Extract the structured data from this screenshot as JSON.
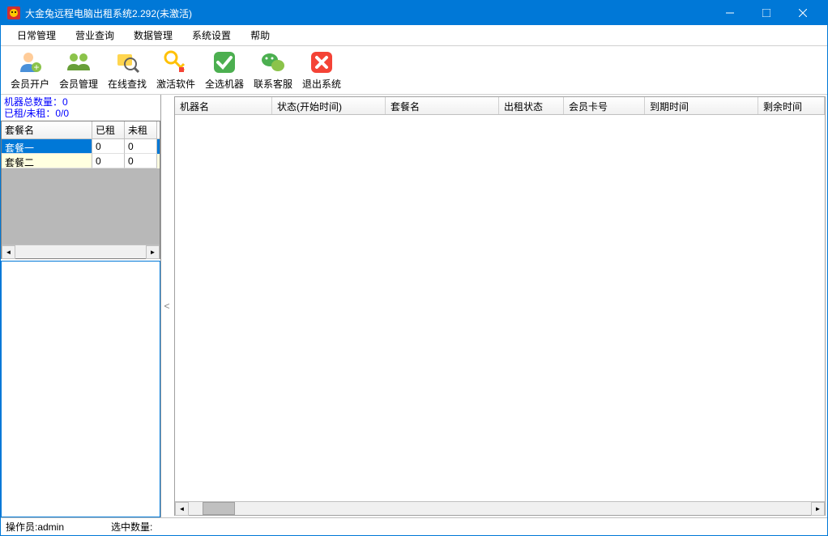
{
  "window": {
    "title": "大金兔远程电脑出租系统2.292(未激活)"
  },
  "menu": {
    "daily": "日常管理",
    "business": "营业查询",
    "data": "数据管理",
    "system": "系统设置",
    "help": "帮助"
  },
  "toolbar": {
    "member_open": "会员开户",
    "member_manage": "会员管理",
    "online_search": "在线查找",
    "activate": "激活软件",
    "select_all": "全选机器",
    "contact": "联系客服",
    "exit": "退出系统"
  },
  "stats": {
    "total_machines": "机器总数量：0",
    "rented_unrented": "已租/未租：0/0"
  },
  "package_table": {
    "col_name": "套餐名",
    "col_rented": "已租",
    "col_unrented": "未租",
    "rows": [
      {
        "name": "套餐一",
        "rented": "0",
        "unrented": "0"
      },
      {
        "name": "套餐二",
        "rented": "0",
        "unrented": "0"
      }
    ]
  },
  "main_grid": {
    "col_machine": "机器名",
    "col_status": "状态(开始时间)",
    "col_package": "套餐名",
    "col_rent_status": "出租状态",
    "col_card": "会员卡号",
    "col_expire": "到期时间",
    "col_remaining": "剩余时间"
  },
  "statusbar": {
    "operator": "操作员:admin",
    "selected": "选中数量:"
  },
  "splitter_label": "<"
}
